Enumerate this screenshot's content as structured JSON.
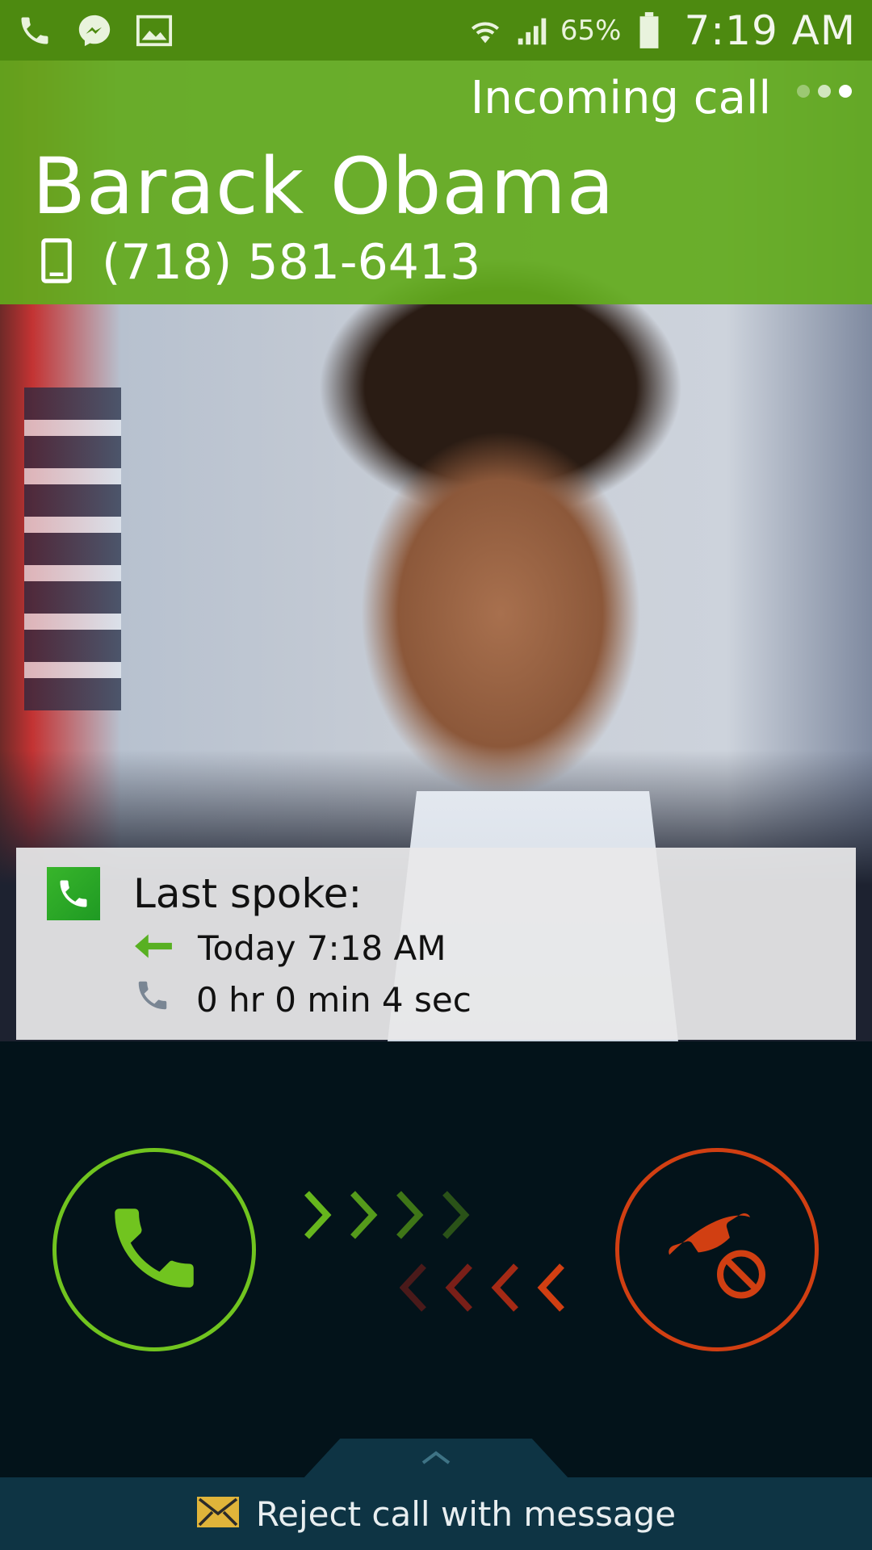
{
  "status_bar": {
    "icons": [
      "phone-icon",
      "messenger-icon",
      "gallery-icon",
      "wifi-icon",
      "signal-icon",
      "battery-icon"
    ],
    "battery": "65%",
    "time": "7:19 AM"
  },
  "call": {
    "state": "Incoming call",
    "caller_name": "Barack Obama",
    "number": "(718) 581-6413"
  },
  "last_spoke": {
    "title": "Last spoke:",
    "time": "Today 7:18 AM",
    "duration": "0 hr 0 min 4 sec"
  },
  "controls": {
    "reject_message": "Reject call with message"
  },
  "colors": {
    "header_green": "#62aa1c",
    "status_green": "#4d8a10",
    "answer_green": "#71c41f",
    "reject_red": "#d13f12",
    "bottom_bg": "#03131a",
    "message_bar": "#0e3444"
  }
}
